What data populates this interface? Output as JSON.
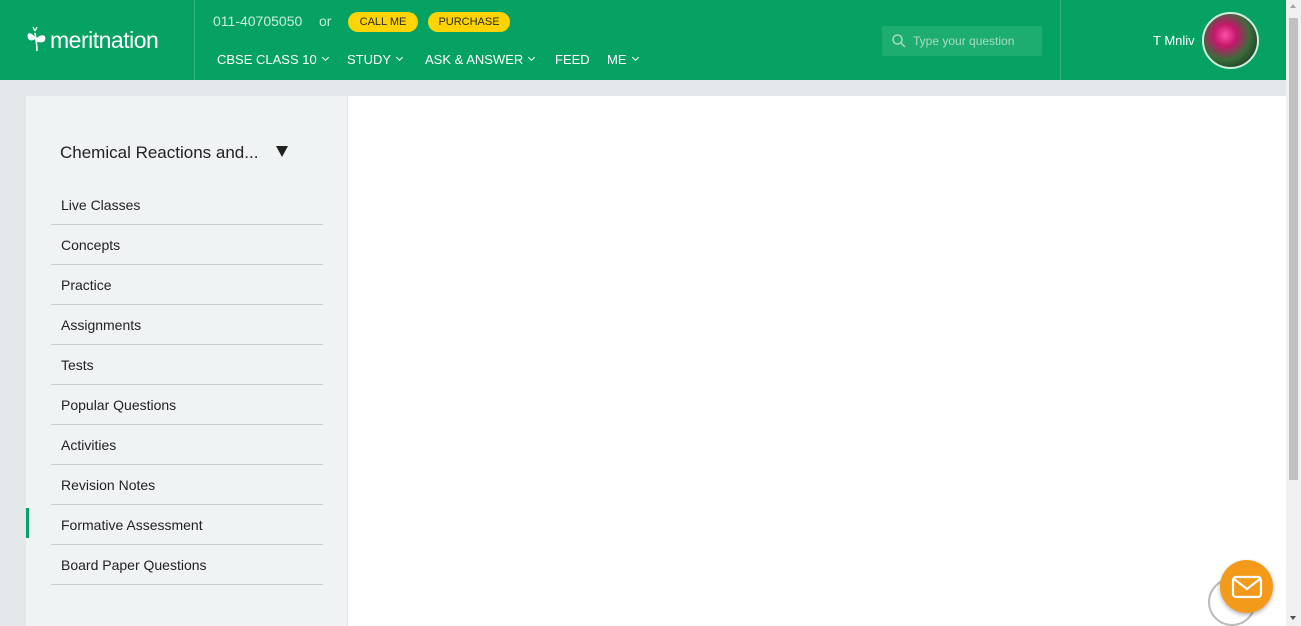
{
  "header": {
    "logo_text": "meritnation",
    "phone": "011-40705050",
    "or": "or",
    "call_me": "CALL ME",
    "purchase": "PURCHASE",
    "nav": [
      {
        "label": "CBSE CLASS 10",
        "has_dropdown": true
      },
      {
        "label": "STUDY",
        "has_dropdown": true
      },
      {
        "label": "ASK & ANSWER",
        "has_dropdown": true
      },
      {
        "label": "FEED",
        "has_dropdown": false
      },
      {
        "label": "ME",
        "has_dropdown": true
      }
    ],
    "search_placeholder": "Type your question",
    "user_name": "T Mnliv"
  },
  "sidebar": {
    "chapter": "Chemical Reactions and...",
    "items": [
      {
        "label": "Live Classes"
      },
      {
        "label": "Concepts"
      },
      {
        "label": "Practice"
      },
      {
        "label": "Assignments"
      },
      {
        "label": "Tests"
      },
      {
        "label": "Popular Questions"
      },
      {
        "label": "Activities"
      },
      {
        "label": "Revision Notes"
      },
      {
        "label": "Formative Assessment"
      },
      {
        "label": "Board Paper Questions"
      }
    ],
    "active_item": "Formative Assessment"
  },
  "colors": {
    "brand_green": "#05a263",
    "button_yellow": "#fdd400",
    "chat_orange": "#f39a1a"
  }
}
